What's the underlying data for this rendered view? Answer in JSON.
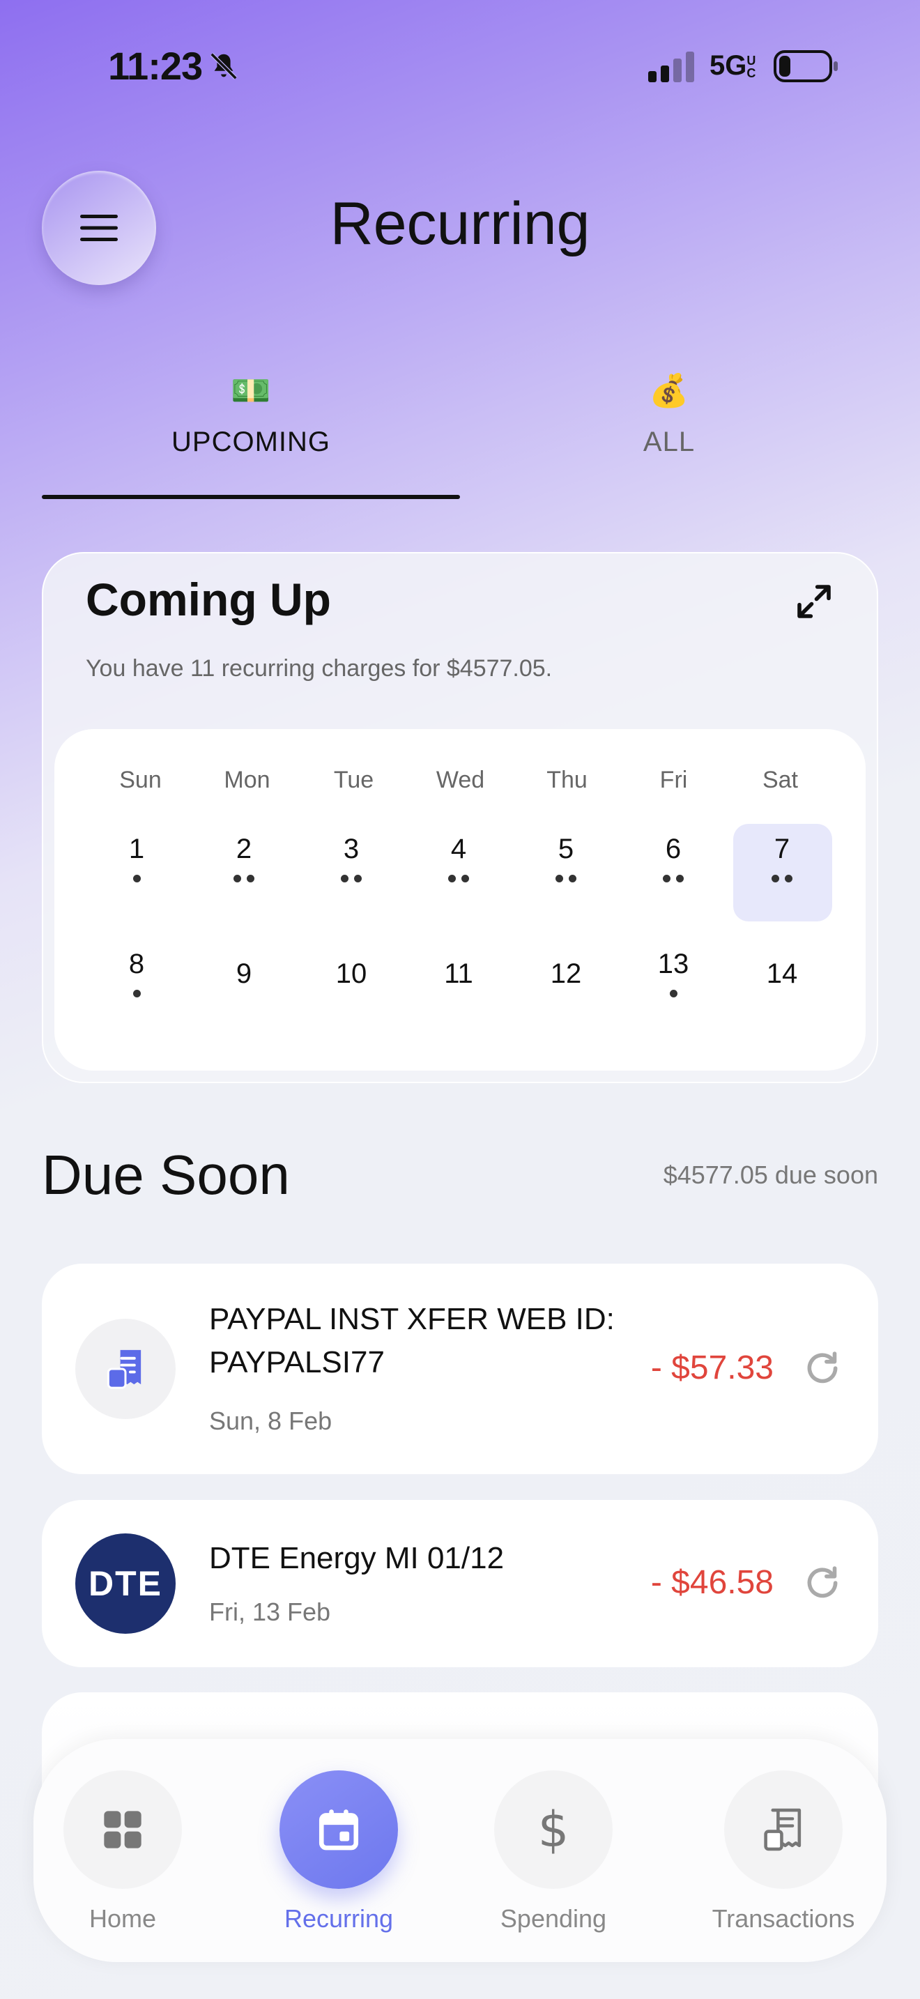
{
  "status_bar": {
    "time": "11:23",
    "network": "5G",
    "network_suffix": "UC"
  },
  "header": {
    "title": "Recurring"
  },
  "tabs": [
    {
      "label": "UPCOMING",
      "emoji": "💵",
      "active": true
    },
    {
      "label": "ALL",
      "emoji": "💰",
      "active": false
    }
  ],
  "coming_up": {
    "title": "Coming Up",
    "subtitle": "You have 11 recurring charges for $4577.05.",
    "calendar": {
      "weekdays": [
        "Sun",
        "Mon",
        "Tue",
        "Wed",
        "Thu",
        "Fri",
        "Sat"
      ],
      "days": [
        {
          "day": "1",
          "charges": 1
        },
        {
          "day": "2",
          "charges": 2
        },
        {
          "day": "3",
          "charges": 2
        },
        {
          "day": "4",
          "charges": 2
        },
        {
          "day": "5",
          "charges": 2
        },
        {
          "day": "6",
          "charges": 2
        },
        {
          "day": "7",
          "charges": 2,
          "selected": true
        },
        {
          "day": "8",
          "charges": 1
        },
        {
          "day": "9",
          "charges": 0
        },
        {
          "day": "10",
          "charges": 0
        },
        {
          "day": "11",
          "charges": 0
        },
        {
          "day": "12",
          "charges": 0
        },
        {
          "day": "13",
          "charges": 1
        },
        {
          "day": "14",
          "charges": 0
        }
      ]
    }
  },
  "due_soon": {
    "title": "Due Soon",
    "total": "$4577.05 due soon",
    "items": [
      {
        "name": "PAYPAL INST XFER WEB ID: PAYPALSI77",
        "date": "Sun, 8 Feb",
        "amount": "- $57.33",
        "icon": "receipt-icon"
      },
      {
        "name": "DTE Energy MI 01/12",
        "date": "Fri, 13 Feb",
        "amount": "- $46.58",
        "icon": "dte-logo",
        "logo_text": "DTE"
      }
    ]
  },
  "bottom_nav": {
    "items": [
      {
        "label": "Home",
        "icon": "grid-icon",
        "active": false
      },
      {
        "label": "Recurring",
        "icon": "calendar-icon",
        "active": true
      },
      {
        "label": "Spending",
        "icon": "dollar-icon",
        "active": false
      },
      {
        "label": "Transactions",
        "icon": "receipt-icon",
        "active": false
      }
    ]
  },
  "colors": {
    "accent": "#6470ea",
    "negative": "#e0453c",
    "dte_brand": "#1d2f6e"
  }
}
